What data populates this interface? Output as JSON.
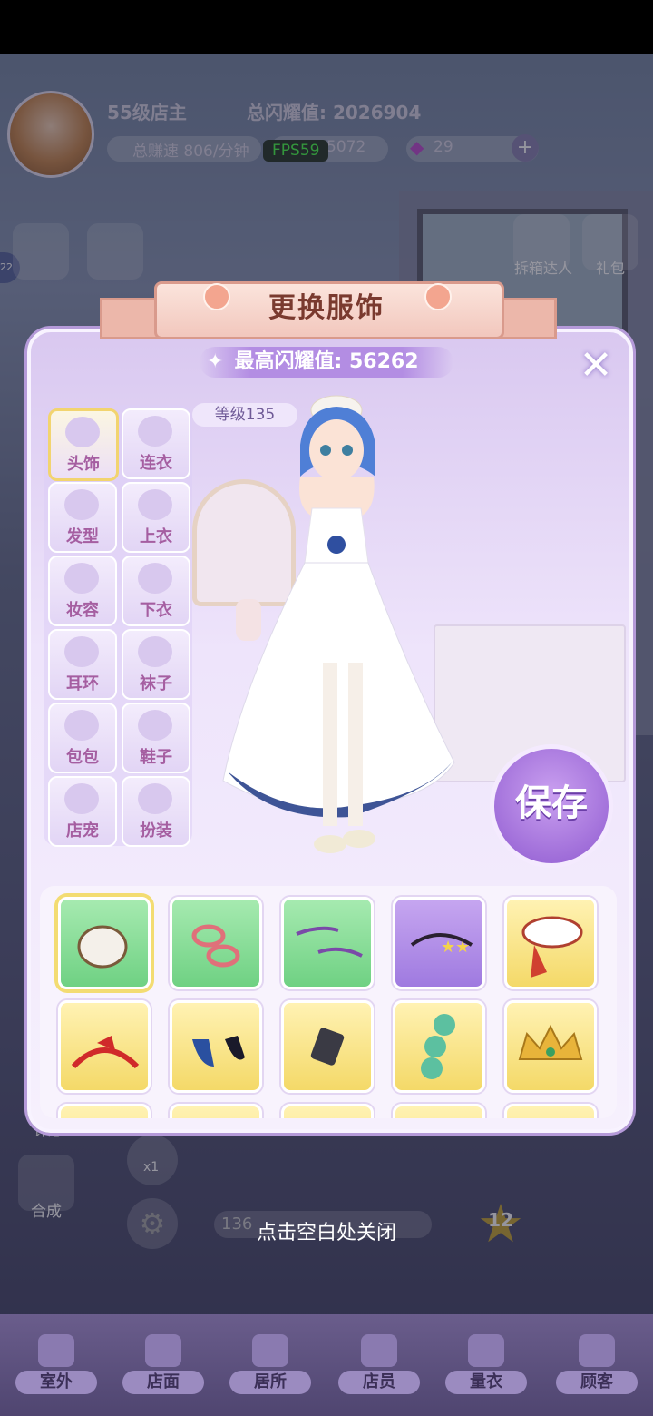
{
  "hud": {
    "level": "55级店主",
    "total_glory_label": "总闪耀值: 2026904",
    "earn_speed": "总赚速 806/分钟",
    "coins": "5072",
    "gems": "29",
    "fps": "FPS59",
    "side_number": "22"
  },
  "side_buttons": {
    "unbox": "拆箱达人",
    "gift": "礼包",
    "synth": "合成",
    "xiaoyu": "许愿",
    "boost": "x1",
    "star_count": "12",
    "progress": "136"
  },
  "panel": {
    "title": "更换服饰",
    "max_glory": "最高闪耀值: 56262",
    "level_tag": "等级135",
    "save": "保存"
  },
  "categories": [
    {
      "label": "头饰",
      "selected": true
    },
    {
      "label": "连衣",
      "selected": false
    },
    {
      "label": "发型",
      "selected": false
    },
    {
      "label": "上衣",
      "selected": false
    },
    {
      "label": "妆容",
      "selected": false
    },
    {
      "label": "下衣",
      "selected": false
    },
    {
      "label": "耳环",
      "selected": false
    },
    {
      "label": "袜子",
      "selected": false
    },
    {
      "label": "包包",
      "selected": false
    },
    {
      "label": "鞋子",
      "selected": false
    },
    {
      "label": "店宠",
      "selected": false
    },
    {
      "label": "扮装",
      "selected": false
    }
  ],
  "items": [
    {
      "icon": "hat-white-icon",
      "rarity": "green",
      "selected": true
    },
    {
      "icon": "hairclip-pink-icon",
      "rarity": "green"
    },
    {
      "icon": "hairpin-purple-icon",
      "rarity": "green"
    },
    {
      "icon": "headband-stars-icon",
      "rarity": "purple"
    },
    {
      "icon": "beret-white-icon",
      "rarity": "yellow"
    },
    {
      "icon": "bow-headband-red-icon",
      "rarity": "yellow"
    },
    {
      "icon": "horns-blue-icon",
      "rarity": "yellow"
    },
    {
      "icon": "clip-black-icon",
      "rarity": "yellow"
    },
    {
      "icon": "clover-clip-icon",
      "rarity": "yellow"
    },
    {
      "icon": "crown-gold-icon",
      "rarity": "yellow"
    }
  ],
  "hint": "点击空白处关闭",
  "nav": [
    {
      "label": "室外"
    },
    {
      "label": "店面"
    },
    {
      "label": "居所"
    },
    {
      "label": "店员"
    },
    {
      "label": "量衣"
    },
    {
      "label": "顾客"
    }
  ]
}
